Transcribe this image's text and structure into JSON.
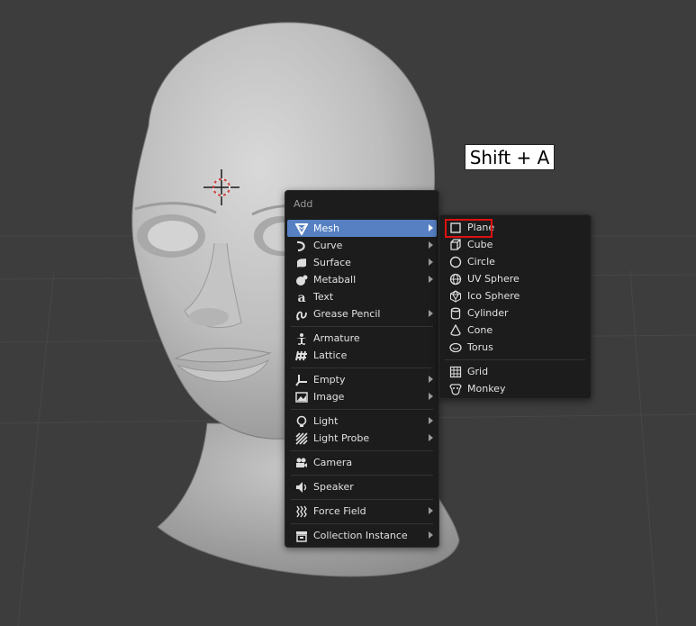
{
  "callout": {
    "text": "Shift + A"
  },
  "add_menu": {
    "title": "Add",
    "items": [
      {
        "label": "Mesh",
        "icon": "mesh-icon",
        "submenu": true,
        "active": true
      },
      {
        "label": "Curve",
        "icon": "curve-icon",
        "submenu": true
      },
      {
        "label": "Surface",
        "icon": "surface-icon",
        "submenu": true
      },
      {
        "label": "Metaball",
        "icon": "metaball-icon",
        "submenu": true
      },
      {
        "label": "Text",
        "icon": "text-icon",
        "submenu": false
      },
      {
        "label": "Grease Pencil",
        "icon": "grease-pencil-icon",
        "submenu": true
      },
      {
        "label": "Armature",
        "icon": "armature-icon",
        "submenu": false
      },
      {
        "label": "Lattice",
        "icon": "lattice-icon",
        "submenu": false
      },
      {
        "label": "Empty",
        "icon": "empty-icon",
        "submenu": true
      },
      {
        "label": "Image",
        "icon": "image-icon",
        "submenu": true
      },
      {
        "label": "Light",
        "icon": "light-icon",
        "submenu": true
      },
      {
        "label": "Light Probe",
        "icon": "light-probe-icon",
        "submenu": true
      },
      {
        "label": "Camera",
        "icon": "camera-icon",
        "submenu": false
      },
      {
        "label": "Speaker",
        "icon": "speaker-icon",
        "submenu": false
      },
      {
        "label": "Force Field",
        "icon": "force-field-icon",
        "submenu": true
      },
      {
        "label": "Collection Instance",
        "icon": "collection-instance-icon",
        "submenu": true
      }
    ]
  },
  "mesh_menu": {
    "items": [
      {
        "label": "Plane",
        "icon": "plane-icon",
        "highlighted": true
      },
      {
        "label": "Cube",
        "icon": "cube-icon"
      },
      {
        "label": "Circle",
        "icon": "circle-icon"
      },
      {
        "label": "UV Sphere",
        "icon": "uv-sphere-icon"
      },
      {
        "label": "Ico Sphere",
        "icon": "ico-sphere-icon"
      },
      {
        "label": "Cylinder",
        "icon": "cylinder-icon"
      },
      {
        "label": "Cone",
        "icon": "cone-icon"
      },
      {
        "label": "Torus",
        "icon": "torus-icon"
      },
      {
        "label": "Grid",
        "icon": "grid-icon"
      },
      {
        "label": "Monkey",
        "icon": "monkey-icon"
      }
    ]
  },
  "colors": {
    "viewport_bg": "#3d3d3d",
    "menu_bg": "#1c1c1c",
    "active_item": "#5680c2",
    "highlight_box": "#e01010"
  }
}
